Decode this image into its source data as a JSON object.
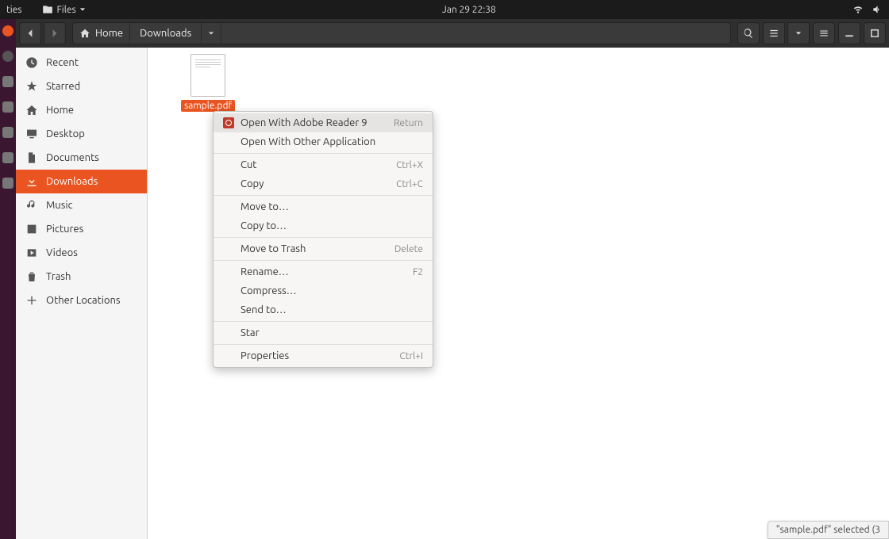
{
  "topbar": {
    "activities": "ties",
    "app_menu": "Files",
    "clock": "Jan 29  22:38"
  },
  "breadcrumbs": {
    "home": "Home",
    "current": "Downloads"
  },
  "sidebar": [
    {
      "id": "recent",
      "label": "Recent"
    },
    {
      "id": "starred",
      "label": "Starred"
    },
    {
      "id": "home",
      "label": "Home"
    },
    {
      "id": "desktop",
      "label": "Desktop"
    },
    {
      "id": "documents",
      "label": "Documents"
    },
    {
      "id": "downloads",
      "label": "Downloads",
      "active": true
    },
    {
      "id": "music",
      "label": "Music"
    },
    {
      "id": "pictures",
      "label": "Pictures"
    },
    {
      "id": "videos",
      "label": "Videos"
    },
    {
      "id": "trash",
      "label": "Trash"
    },
    {
      "id": "other",
      "label": "Other Locations"
    }
  ],
  "file": {
    "name": "sample.pdf"
  },
  "context_menu": [
    {
      "label": "Open With Adobe Reader 9",
      "shortcut": "Return",
      "icon": true,
      "highlight": true
    },
    {
      "label": "Open With Other Application"
    },
    {
      "sep": true
    },
    {
      "label": "Cut",
      "shortcut": "Ctrl+X"
    },
    {
      "label": "Copy",
      "shortcut": "Ctrl+C"
    },
    {
      "sep": true
    },
    {
      "label": "Move to…"
    },
    {
      "label": "Copy to…"
    },
    {
      "sep": true
    },
    {
      "label": "Move to Trash",
      "shortcut": "Delete"
    },
    {
      "sep": true
    },
    {
      "label": "Rename…",
      "shortcut": "F2"
    },
    {
      "label": "Compress…"
    },
    {
      "label": "Send to…"
    },
    {
      "sep": true
    },
    {
      "label": "Star"
    },
    {
      "sep": true
    },
    {
      "label": "Properties",
      "shortcut": "Ctrl+I"
    }
  ],
  "status": "\"sample.pdf\" selected  (3"
}
